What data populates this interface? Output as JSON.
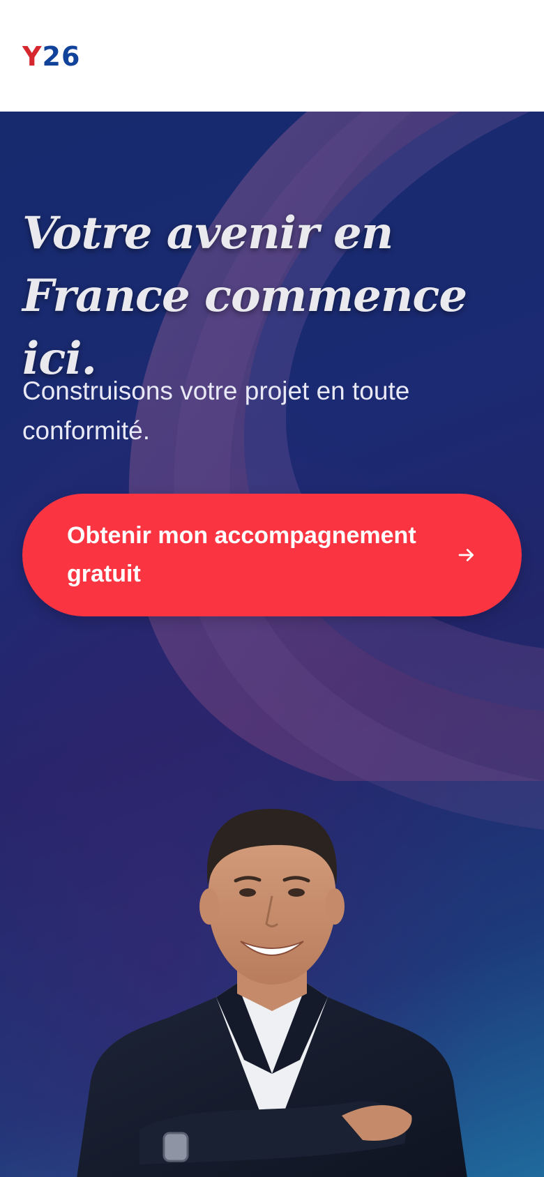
{
  "header": {
    "logo": {
      "letter": "Y",
      "number": "26",
      "colors": {
        "letter": "#d6262e",
        "number": "#12439a"
      }
    }
  },
  "hero": {
    "title": "Votre avenir en France commence ici.",
    "subtitle": "Construisons votre projet en toute conformité.",
    "cta": {
      "label": "Obtenir mon accompagnement gratuit",
      "icon": "arrow-right-icon",
      "color": "#fb3442"
    }
  },
  "colors": {
    "hero_background": "#1b2a72",
    "accent": "#fb3442"
  }
}
